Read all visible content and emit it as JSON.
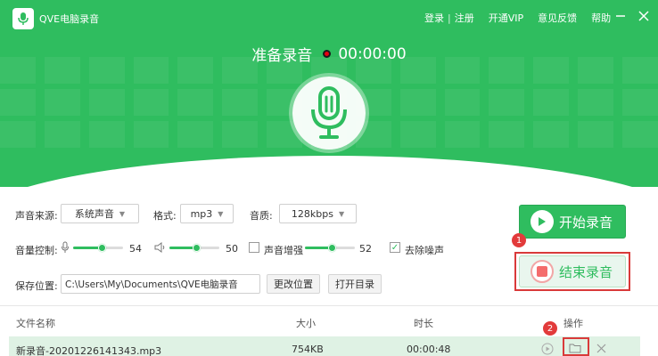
{
  "app": {
    "title": "QVE电脑录音",
    "links": {
      "login": "登录",
      "separator": "|",
      "register": "注册",
      "vip": "开通VIP",
      "feedback": "意见反馈",
      "help": "帮助"
    }
  },
  "status": {
    "text": "准备录音",
    "time": "00:00:00"
  },
  "settings": {
    "source_label": "声音来源:",
    "source_value": "系统声音",
    "format_label": "格式:",
    "format_value": "mp3",
    "quality_label": "音质:",
    "quality_value": "128kbps",
    "volume_label": "音量控制:",
    "mic_volume": "54",
    "speaker_volume": "50",
    "boost_label": "声音增强",
    "boost_checked": false,
    "boost_value": "52",
    "denoise_label": "去除噪声",
    "denoise_checked": true,
    "save_label": "保存位置:",
    "save_path": "C:\\Users\\My\\Documents\\QVE电脑录音",
    "change_btn": "更改位置",
    "open_btn": "打开目录"
  },
  "actions": {
    "start": "开始录音",
    "stop": "结束录音",
    "step1": "1",
    "step2": "2"
  },
  "table": {
    "headers": {
      "name": "文件名称",
      "size": "大小",
      "duration": "时长",
      "ops": "操作"
    },
    "rows": [
      {
        "name": "新录音-20201226141343.mp3",
        "size": "754KB",
        "duration": "00:00:48"
      }
    ]
  },
  "colors": {
    "accent": "#2fbd5f",
    "highlight": "#d93a3a"
  }
}
